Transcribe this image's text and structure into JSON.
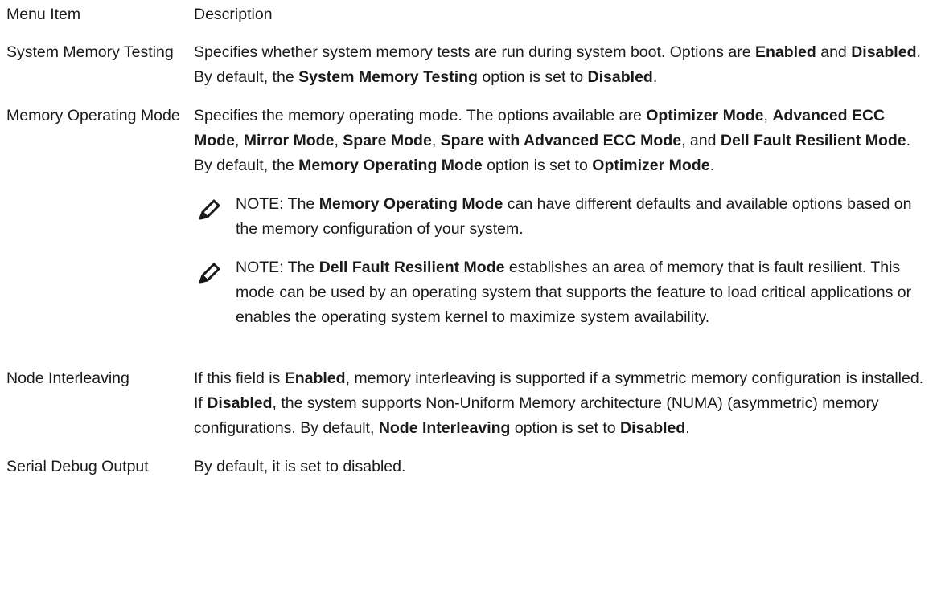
{
  "header": {
    "col_item": "Menu Item",
    "col_desc": "Description"
  },
  "rows": [
    {
      "item": "System Memory Testing",
      "desc": [
        {
          "t": "Specifies whether system memory tests are run during system boot. Options are "
        },
        {
          "t": "Enabled",
          "b": true
        },
        {
          "t": " and "
        },
        {
          "t": "Disabled",
          "b": true
        },
        {
          "t": ". By default, the "
        },
        {
          "t": "System Memory Testing",
          "b": true
        },
        {
          "t": " option is set to "
        },
        {
          "t": "Disabled",
          "b": true
        },
        {
          "t": "."
        }
      ]
    },
    {
      "item": "Memory Operating Mode",
      "desc": [
        {
          "t": "Specifies the memory operating mode. The options available are "
        },
        {
          "t": "Optimizer Mode",
          "b": true
        },
        {
          "t": ", "
        },
        {
          "t": "Advanced ECC Mode",
          "b": true
        },
        {
          "t": ", "
        },
        {
          "t": "Mirror Mode",
          "b": true
        },
        {
          "t": ", "
        },
        {
          "t": "Spare Mode",
          "b": true
        },
        {
          "t": ", "
        },
        {
          "t": "Spare with Advanced ECC Mode",
          "b": true
        },
        {
          "t": ", and "
        },
        {
          "t": "Dell Fault Resilient Mode",
          "b": true
        },
        {
          "t": ". By default, the "
        },
        {
          "t": "Memory Operating Mode",
          "b": true
        },
        {
          "t": " option is set to "
        },
        {
          "t": "Optimizer Mode",
          "b": true
        },
        {
          "t": "."
        }
      ],
      "notes": [
        [
          {
            "t": "NOTE:",
            "label": true
          },
          {
            "t": " The "
          },
          {
            "t": "Memory Operating Mode",
            "b": true
          },
          {
            "t": " can have different defaults and available options based on the memory configuration of your system."
          }
        ],
        [
          {
            "t": "NOTE:",
            "label": true
          },
          {
            "t": " The "
          },
          {
            "t": "Dell Fault Resilient Mode",
            "b": true
          },
          {
            "t": " establishes an area of memory that is fault resilient. This mode can be used by an operating system that supports the feature to load critical applications or enables the operating system kernel to maximize system availability."
          }
        ]
      ]
    },
    {
      "item": "Node Interleaving",
      "desc": [
        {
          "t": "If this field is "
        },
        {
          "t": "Enabled",
          "b": true
        },
        {
          "t": ", memory interleaving is supported if a symmetric memory configuration is installed. If "
        },
        {
          "t": "Disabled",
          "b": true
        },
        {
          "t": ", the system supports Non-Uniform Memory architecture (NUMA) (asymmetric) memory configurations. By default, "
        },
        {
          "t": "Node Interleaving",
          "b": true
        },
        {
          "t": " option is set to "
        },
        {
          "t": "Disabled",
          "b": true
        },
        {
          "t": "."
        }
      ]
    },
    {
      "item": "Serial Debug Output",
      "desc": [
        {
          "t": "By default, it is set to disabled."
        }
      ]
    }
  ],
  "icons": {
    "note": "pencil-note-icon"
  }
}
